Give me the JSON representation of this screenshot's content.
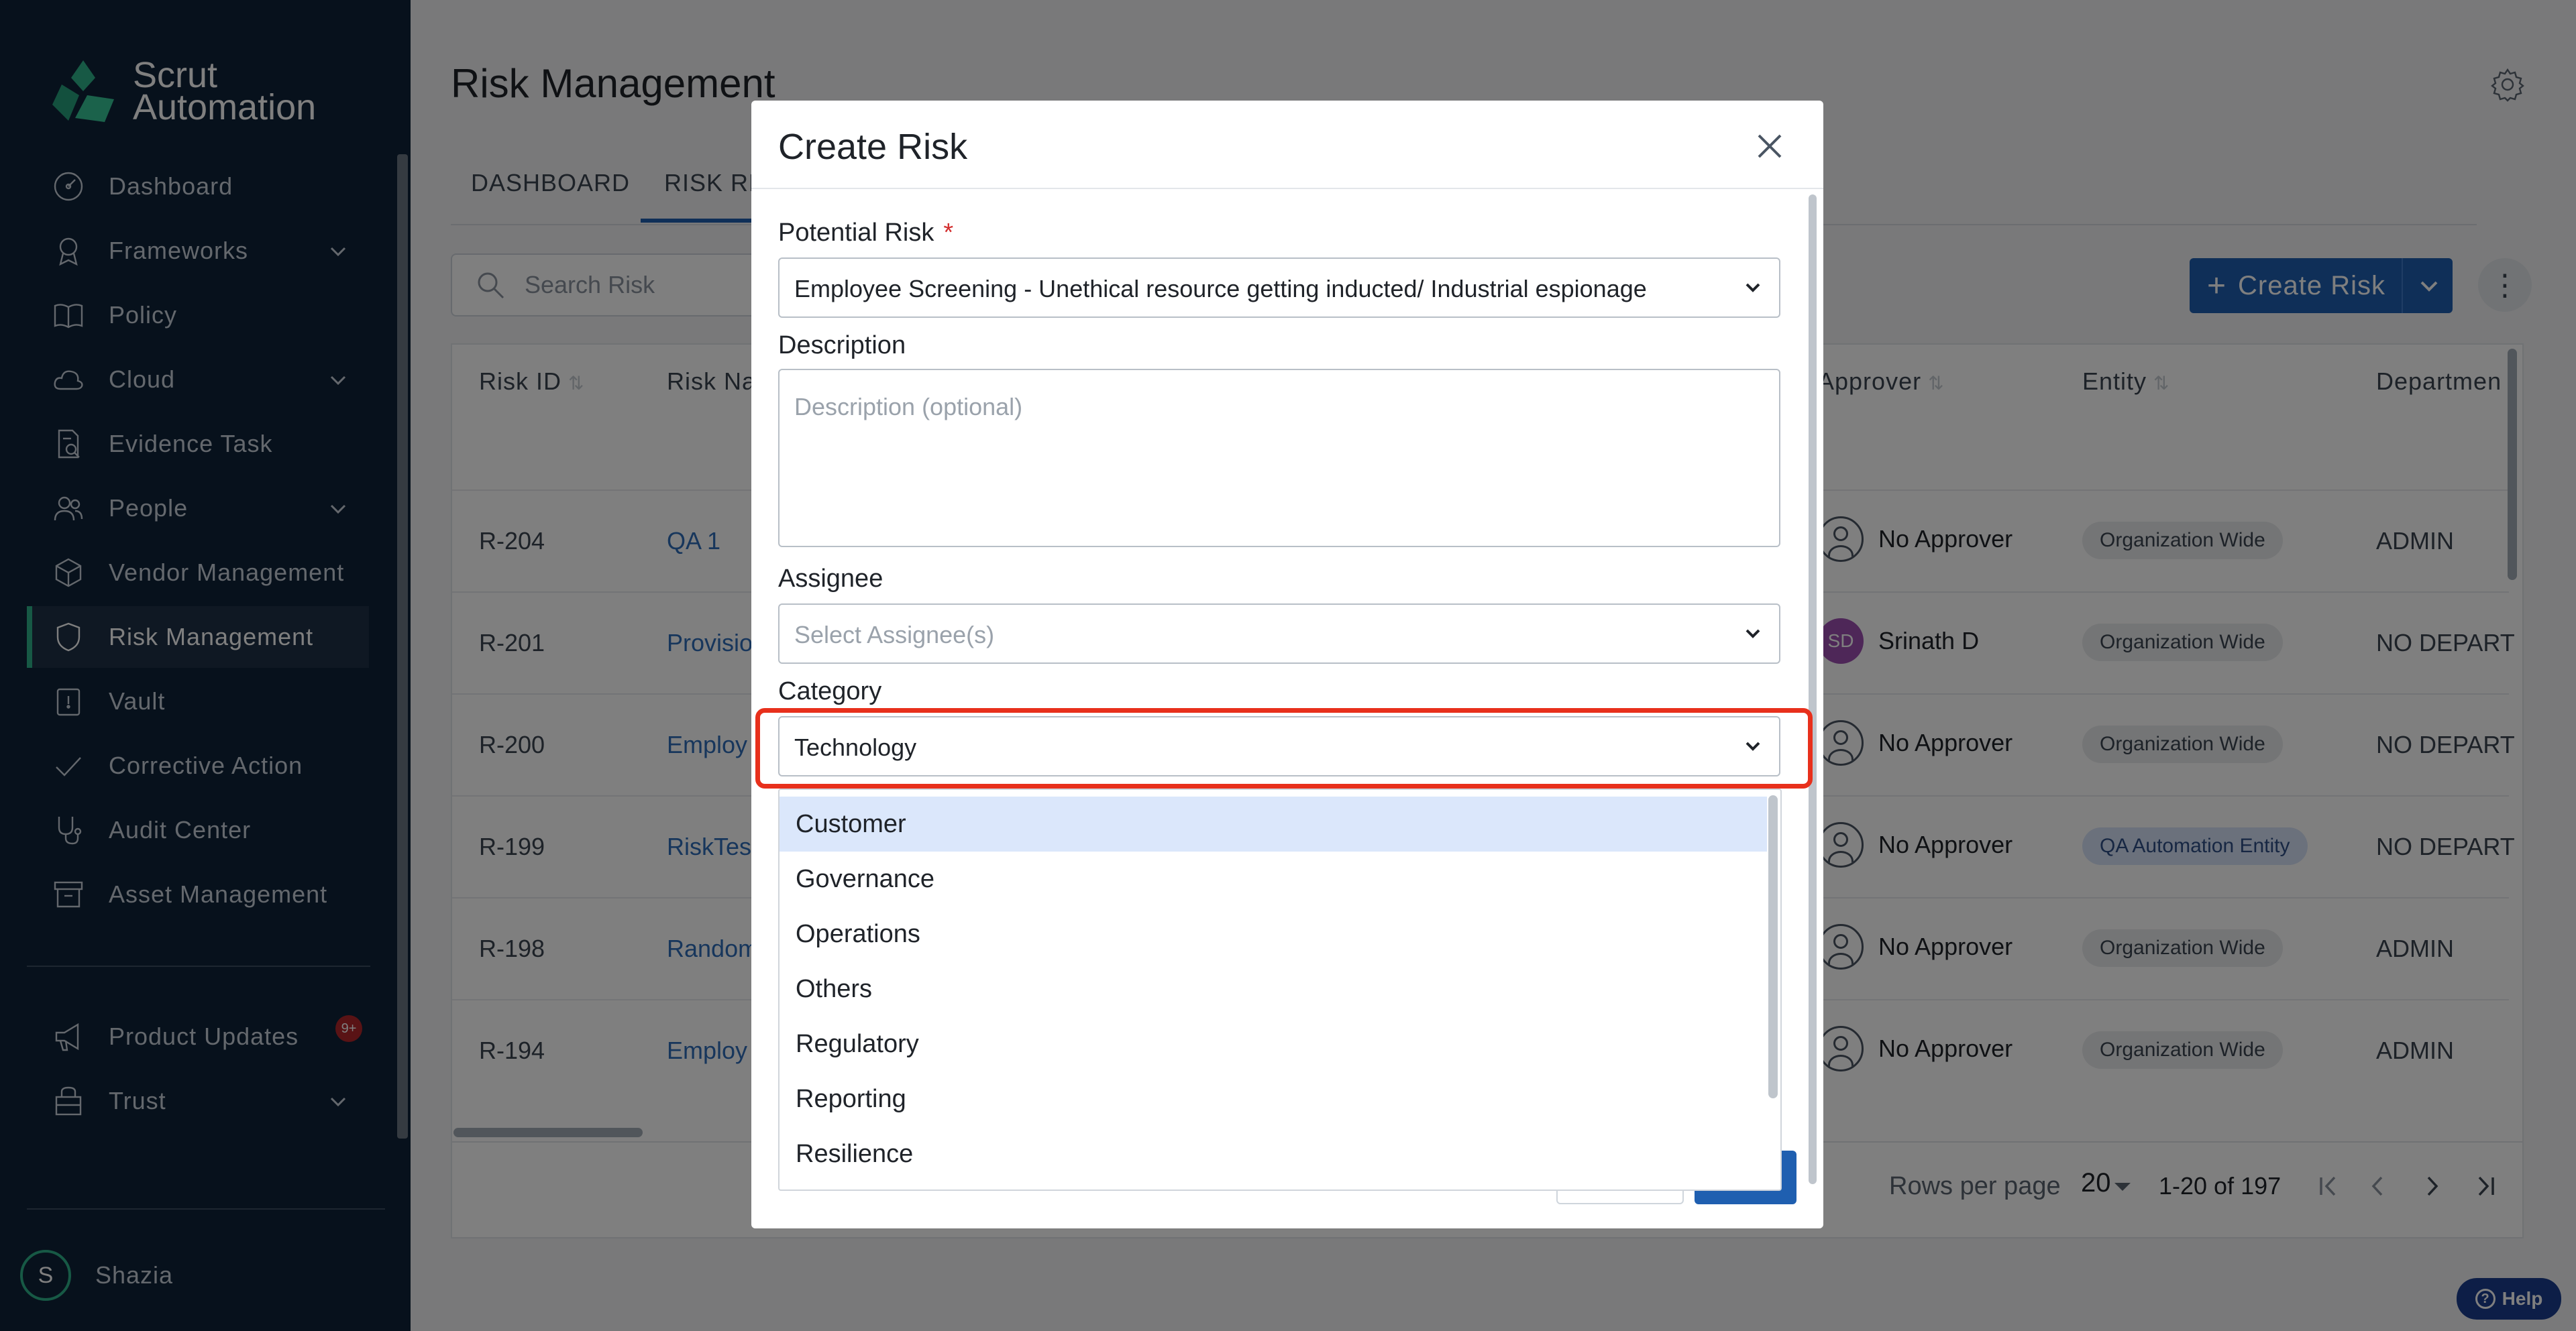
{
  "app": {
    "logo_text": "Scrut Automation"
  },
  "sidebar": {
    "items": [
      {
        "label": "Dashboard",
        "icon": "dashboard-icon",
        "chevron": false
      },
      {
        "label": "Frameworks",
        "icon": "frameworks-icon",
        "chevron": true
      },
      {
        "label": "Policy",
        "icon": "policy-icon",
        "chevron": false
      },
      {
        "label": "Cloud",
        "icon": "cloud-icon",
        "chevron": true
      },
      {
        "label": "Evidence Task",
        "icon": "evidence-icon",
        "chevron": false
      },
      {
        "label": "People",
        "icon": "people-icon",
        "chevron": true
      },
      {
        "label": "Vendor Management",
        "icon": "vendor-icon",
        "chevron": false
      },
      {
        "label": "Risk Management",
        "icon": "shield-icon",
        "chevron": false,
        "active": true
      },
      {
        "label": "Vault",
        "icon": "vault-icon",
        "chevron": false
      },
      {
        "label": "Corrective Action",
        "icon": "check-icon",
        "chevron": false
      },
      {
        "label": "Audit Center",
        "icon": "stethoscope-icon",
        "chevron": false
      },
      {
        "label": "Asset Management",
        "icon": "archive-icon",
        "chevron": false
      }
    ],
    "bottom_items": [
      {
        "label": "Product Updates",
        "icon": "megaphone-icon",
        "badge": "9+"
      },
      {
        "label": "Trust",
        "icon": "trust-icon",
        "chevron": true
      }
    ],
    "user": {
      "initial": "S",
      "name": "Shazia"
    }
  },
  "main": {
    "title": "Risk Management",
    "tabs": [
      "DASHBOARD",
      "RISK REG"
    ],
    "search_placeholder": "Search Risk",
    "create_button": "Create Risk",
    "more_button": "⋮",
    "table": {
      "headers": {
        "risk_id": "Risk ID",
        "risk_name": "Risk Na",
        "approver": "Approver",
        "entity": "Entity",
        "department": "Departmen"
      },
      "rows": [
        {
          "id": "R-204",
          "name": "QA 1",
          "approver": "No Approver",
          "avatar": "",
          "entity": "Organization Wide",
          "entity_style": "grey",
          "department": "ADMIN"
        },
        {
          "id": "R-201",
          "name": "Provisio",
          "approver": "Srinath D",
          "avatar": "SD",
          "entity": "Organization Wide",
          "entity_style": "grey",
          "department": "NO DEPART"
        },
        {
          "id": "R-200",
          "name": "Employ",
          "approver": "No Approver",
          "avatar": "",
          "entity": "Organization Wide",
          "entity_style": "grey",
          "department": "NO DEPART"
        },
        {
          "id": "R-199",
          "name": "RiskTes",
          "approver": "No Approver",
          "avatar": "",
          "entity": "QA Automation Entity",
          "entity_style": "blue",
          "department": "NO DEPART"
        },
        {
          "id": "R-198",
          "name": "Random",
          "approver": "No Approver",
          "avatar": "",
          "entity": "Organization Wide",
          "entity_style": "grey",
          "department": "ADMIN"
        },
        {
          "id": "R-194",
          "name": "Employ",
          "approver": "No Approver",
          "avatar": "",
          "entity": "Organization Wide",
          "entity_style": "grey",
          "department": "ADMIN"
        }
      ]
    },
    "pagination": {
      "rows_per_page_label": "Rows per page",
      "rows_per_page": "20",
      "range": "1-20 of 197"
    },
    "help_label": "Help"
  },
  "modal": {
    "title": "Create Risk",
    "potential_risk": {
      "label": "Potential Risk",
      "required_mark": "*",
      "value": "Employee Screening - Unethical resource getting inducted/ Industrial espionage"
    },
    "description": {
      "label": "Description",
      "placeholder": "Description (optional)"
    },
    "assignee": {
      "label": "Assignee",
      "placeholder": "Select Assignee(s)"
    },
    "category": {
      "label": "Category",
      "value": "Technology",
      "options": [
        "Customer",
        "Governance",
        "Operations",
        "Others",
        "Regulatory",
        "Reporting",
        "Resilience"
      ],
      "highlighted_option": "Customer"
    }
  },
  "colors": {
    "sidebar_bg": "#0f2238",
    "accent": "#2fb38b",
    "primary_button": "#1f5fb0",
    "highlight_outline": "#e8301c",
    "selected_option_bg": "#dbe7fb"
  }
}
